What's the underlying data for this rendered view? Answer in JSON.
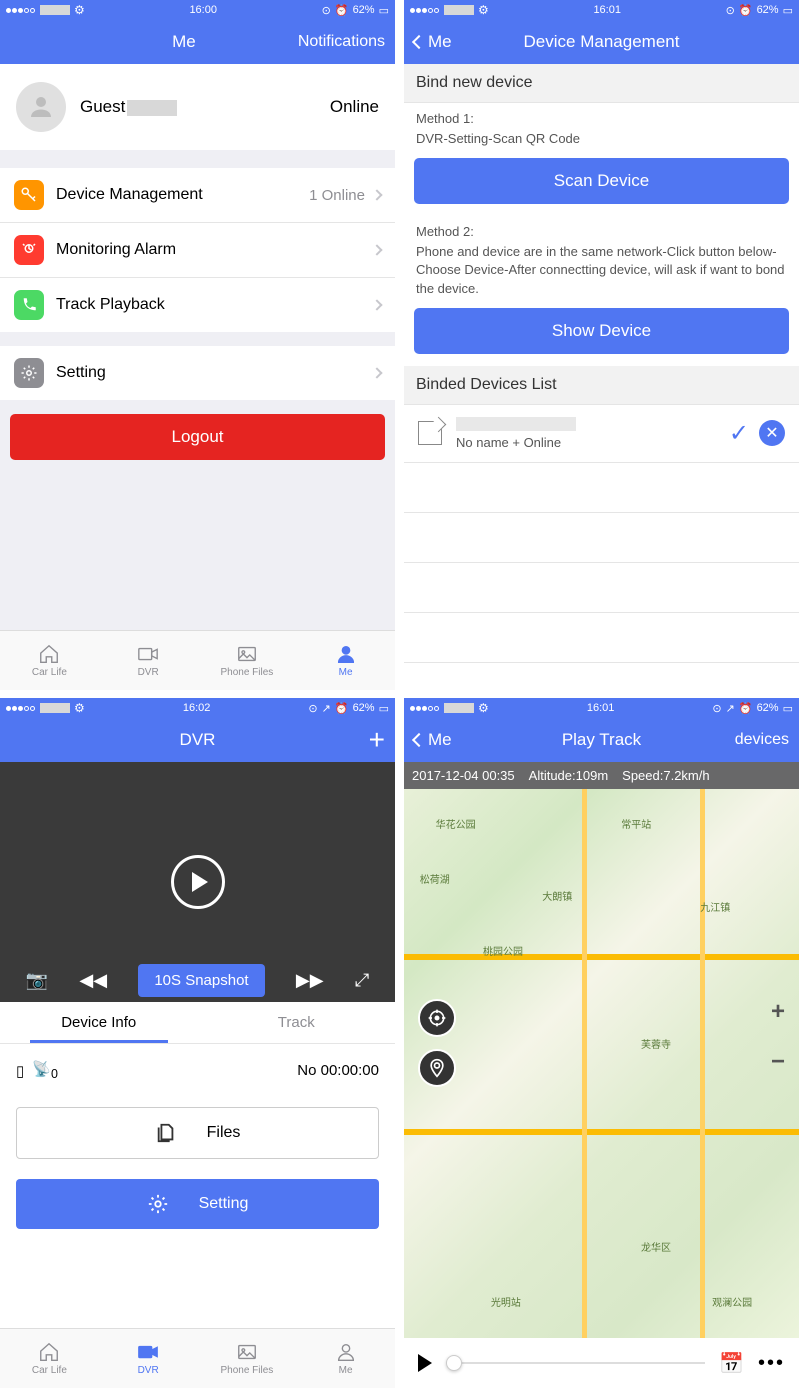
{
  "status": {
    "time1": "16:00",
    "time2": "16:01",
    "time3": "16:02",
    "time4": "16:01",
    "battery": "62%"
  },
  "tabs": {
    "carlife": "Car Life",
    "dvr": "DVR",
    "phonefiles": "Phone Files",
    "me": "Me"
  },
  "me": {
    "title": "Me",
    "notifications": "Notifications",
    "guest": "Guest",
    "online": "Online",
    "items": {
      "device_mgmt": "Device Management",
      "device_detail": "1 Online",
      "monitoring": "Monitoring Alarm",
      "track": "Track Playback",
      "setting": "Setting"
    },
    "logout": "Logout"
  },
  "dm": {
    "back": "Me",
    "title": "Device Management",
    "bind_h": "Bind new device",
    "m1": "Method 1:",
    "m1d": "DVR-Setting-Scan QR Code",
    "scan": "Scan Device",
    "m2": "Method 2:",
    "m2d": "Phone and device are in the same network-Click button below-Choose Device-After connectting device, will ask if want to bond the device.",
    "show": "Show Device",
    "list_h": "Binded Devices List",
    "dev_status": "No name + Online"
  },
  "dvr": {
    "title": "DVR",
    "snap": "10S Snapshot",
    "tab_info": "Device Info",
    "tab_track": "Track",
    "sat": "0",
    "no": "No 00:00:00",
    "files": "Files",
    "setting": "Setting"
  },
  "pt": {
    "back": "Me",
    "title": "Play Track",
    "devices": "devices",
    "date": "2017-12-04 00:35",
    "alt": "Altitude:109m",
    "speed": "Speed:7.2km/h",
    "labels": [
      "华花公园",
      "松荷湖",
      "桃园公园",
      "常平站",
      "九江镇",
      "芙蓉寺",
      "龙华区",
      "光明站",
      "观澜公园",
      "大朗镇"
    ]
  }
}
